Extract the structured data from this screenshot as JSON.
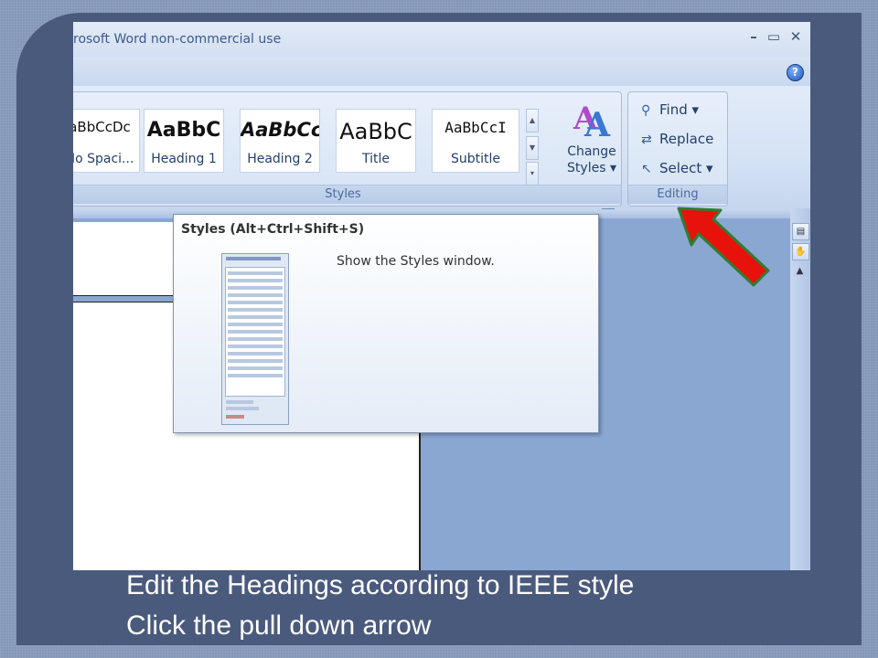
{
  "window": {
    "title": "rosoft Word non-commercial use",
    "minimize": "–",
    "maximize": "▭",
    "close": "✕",
    "help": "?"
  },
  "styles_group": {
    "label": "Styles",
    "tiles": [
      {
        "sample": "aBbCcDc",
        "name": "No Spaci..."
      },
      {
        "sample": "AaBbC",
        "name": "Heading 1"
      },
      {
        "sample": "AaBbCc",
        "name": "Heading 2"
      },
      {
        "sample": "AaBbC",
        "name": "Title"
      },
      {
        "sample": "AaBbCcI",
        "name": "Subtitle"
      }
    ],
    "change_styles": {
      "line1": "Change",
      "line2": "Styles ▾"
    }
  },
  "editing_group": {
    "label": "Editing",
    "find": "Find ▾",
    "replace": "Replace",
    "select": "Select ▾"
  },
  "tooltip": {
    "title": "Styles (Alt+Ctrl+Shift+S)",
    "description": "Show the Styles window."
  },
  "caption": {
    "line1": "Edit the Headings according to IEEE style",
    "line2": "Click the pull down arrow"
  },
  "colors": {
    "frame": "#4a5a7d",
    "arrow_fill": "#e8120c",
    "arrow_stroke": "#2e7d32"
  }
}
